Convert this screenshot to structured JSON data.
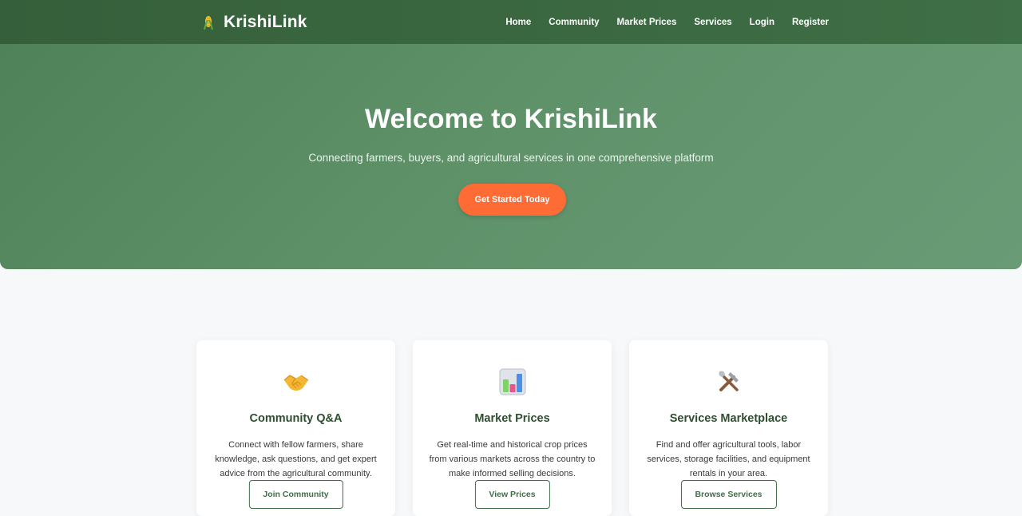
{
  "brand": {
    "name": "KrishiLink",
    "icon": "corn-icon"
  },
  "nav": {
    "links": [
      "Home",
      "Community",
      "Market Prices",
      "Services",
      "Login",
      "Register"
    ]
  },
  "hero": {
    "title": "Welcome to KrishiLink",
    "subtitle": "Connecting farmers, buyers, and agricultural services in one comprehensive platform",
    "cta_label": "Get Started Today"
  },
  "features": [
    {
      "icon": "handshake-icon",
      "title": "Community Q&A",
      "description": "Connect with fellow farmers, share knowledge, ask questions, and get expert advice from the agricultural community.",
      "button_label": "Join Community"
    },
    {
      "icon": "bar-chart-icon",
      "title": "Market Prices",
      "description": "Get real-time and historical crop prices from various markets across the country to make informed selling decisions.",
      "button_label": "View Prices"
    },
    {
      "icon": "tools-icon",
      "title": "Services Marketplace",
      "description": "Find and offer agricultural tools, labor services, storage facilities, and equipment rentals in your area.",
      "button_label": "Browse Services"
    }
  ],
  "colors": {
    "nav_bg": "#3f6f46",
    "hero_bg": "#5f9169",
    "accent": "#ff6b35",
    "title_green": "#2d4f30"
  }
}
